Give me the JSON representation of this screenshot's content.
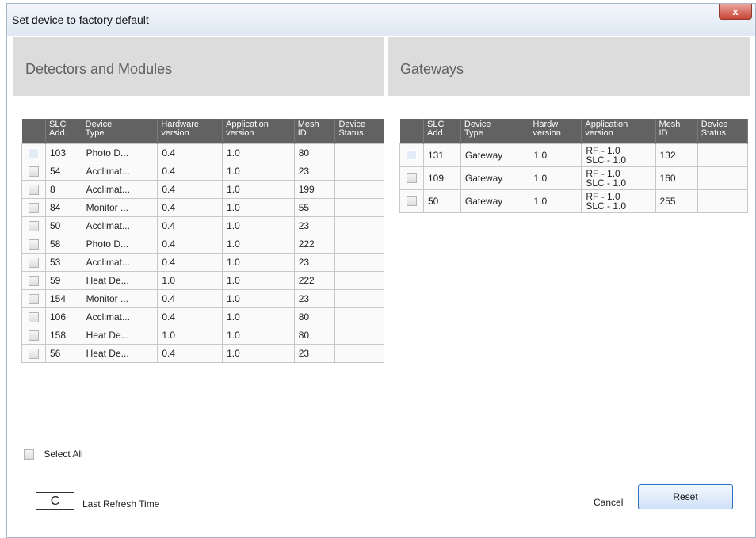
{
  "window": {
    "title": "Set device to factory default",
    "close_label": "x"
  },
  "left_panel": {
    "title": "Detectors and Modules",
    "columns": [
      "",
      "SLC\nAdd.",
      "Device\nType",
      "Hardware\nversion",
      "Application\nversion",
      "Mesh\nID",
      "Device\nStatus"
    ],
    "rows": [
      [
        "103",
        "Photo D...",
        "0.4",
        "1.0",
        "80",
        ""
      ],
      [
        "54",
        "Acclimat...",
        "0.4",
        "1.0",
        "23",
        ""
      ],
      [
        "8",
        "Acclimat...",
        "0.4",
        "1.0",
        "199",
        ""
      ],
      [
        "84",
        "Monitor ...",
        "0.4",
        "1.0",
        "55",
        ""
      ],
      [
        "50",
        "Acclimat...",
        "0.4",
        "1.0",
        "23",
        ""
      ],
      [
        "58",
        "Photo D...",
        "0.4",
        "1.0",
        "222",
        ""
      ],
      [
        "53",
        "Acclimat...",
        "0.4",
        "1.0",
        "23",
        ""
      ],
      [
        "59",
        "Heat De...",
        "1.0",
        "1.0",
        "222",
        ""
      ],
      [
        "154",
        "Monitor ...",
        "0.4",
        "1.0",
        "23",
        ""
      ],
      [
        "106",
        "Acclimat...",
        "0.4",
        "1.0",
        "80",
        ""
      ],
      [
        "158",
        "Heat De...",
        "1.0",
        "1.0",
        "80",
        ""
      ],
      [
        "56",
        "Heat De...",
        "0.4",
        "1.0",
        "23",
        ""
      ]
    ]
  },
  "right_panel": {
    "title": "Gateways",
    "columns": [
      "",
      "SLC\nAdd.",
      "Device\nType",
      "Hardw\nversion",
      "Application\nversion",
      "Mesh\nID",
      "Device\nStatus"
    ],
    "rows": [
      [
        "131",
        "Gateway",
        "1.0",
        "RF - 1.0\nSLC - 1.0",
        "132",
        ""
      ],
      [
        "109",
        "Gateway",
        "1.0",
        "RF - 1.0\nSLC - 1.0",
        "160",
        ""
      ],
      [
        "50",
        "Gateway",
        "1.0",
        "RF - 1.0\nSLC - 1.0",
        "255",
        ""
      ]
    ]
  },
  "footer": {
    "select_all_label": "Select All",
    "refresh_icon": "refresh-icon",
    "refresh_glyph": "C",
    "last_refresh_label": "Last Refresh Time",
    "cancel_label": "Cancel",
    "reset_label": "Reset"
  }
}
